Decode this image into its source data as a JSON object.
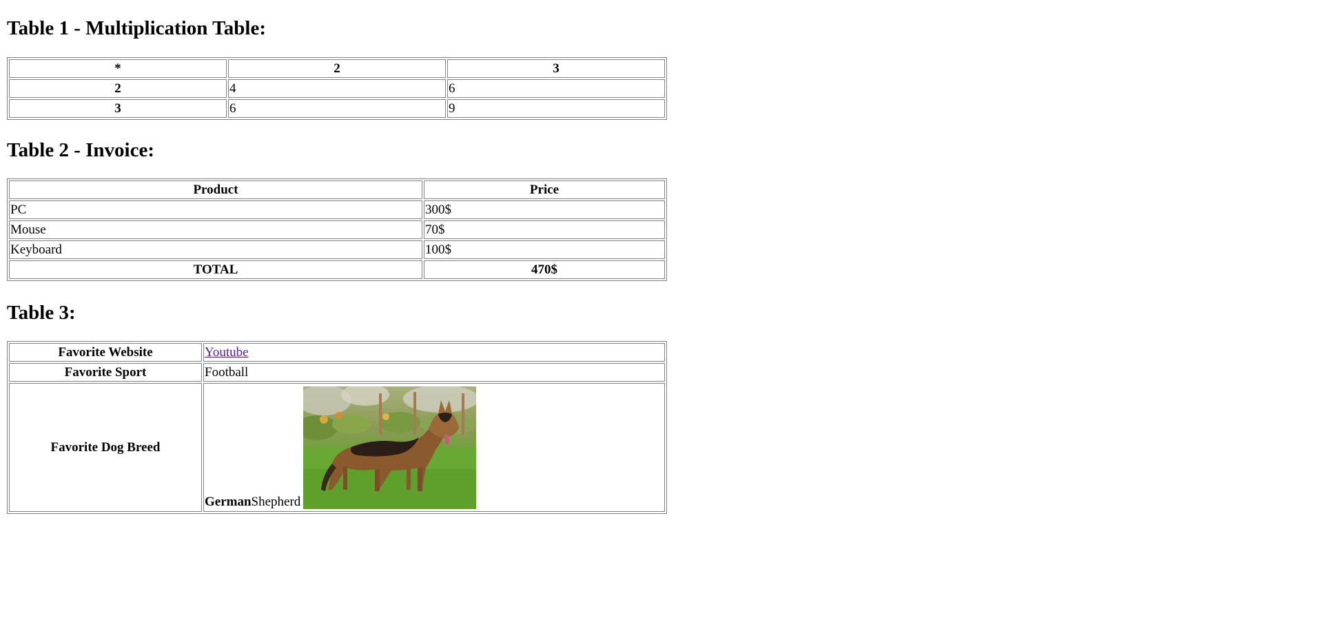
{
  "table1": {
    "heading": "Table 1 - Multiplication Table:",
    "header": [
      "*",
      "2",
      "3"
    ],
    "rows": [
      {
        "label": "2",
        "cells": [
          "4",
          "6"
        ]
      },
      {
        "label": "3",
        "cells": [
          "6",
          "9"
        ]
      }
    ]
  },
  "table2": {
    "heading": "Table 2 - Invoice:",
    "columns": [
      "Product",
      "Price"
    ],
    "rows": [
      {
        "product": "PC",
        "price": "300$"
      },
      {
        "product": "Mouse",
        "price": "70$"
      },
      {
        "product": "Keyboard",
        "price": "100$"
      }
    ],
    "total_label": "TOTAL",
    "total_value": "470$"
  },
  "table3": {
    "heading": "Table 3:",
    "website_label": "Favorite Website",
    "website_value": "Youtube",
    "sport_label": "Favorite Sport",
    "sport_value": "Football",
    "dog_label": "Favorite Dog Breed",
    "dog_value_bold": "German",
    "dog_value_rest": "Shepherd"
  }
}
